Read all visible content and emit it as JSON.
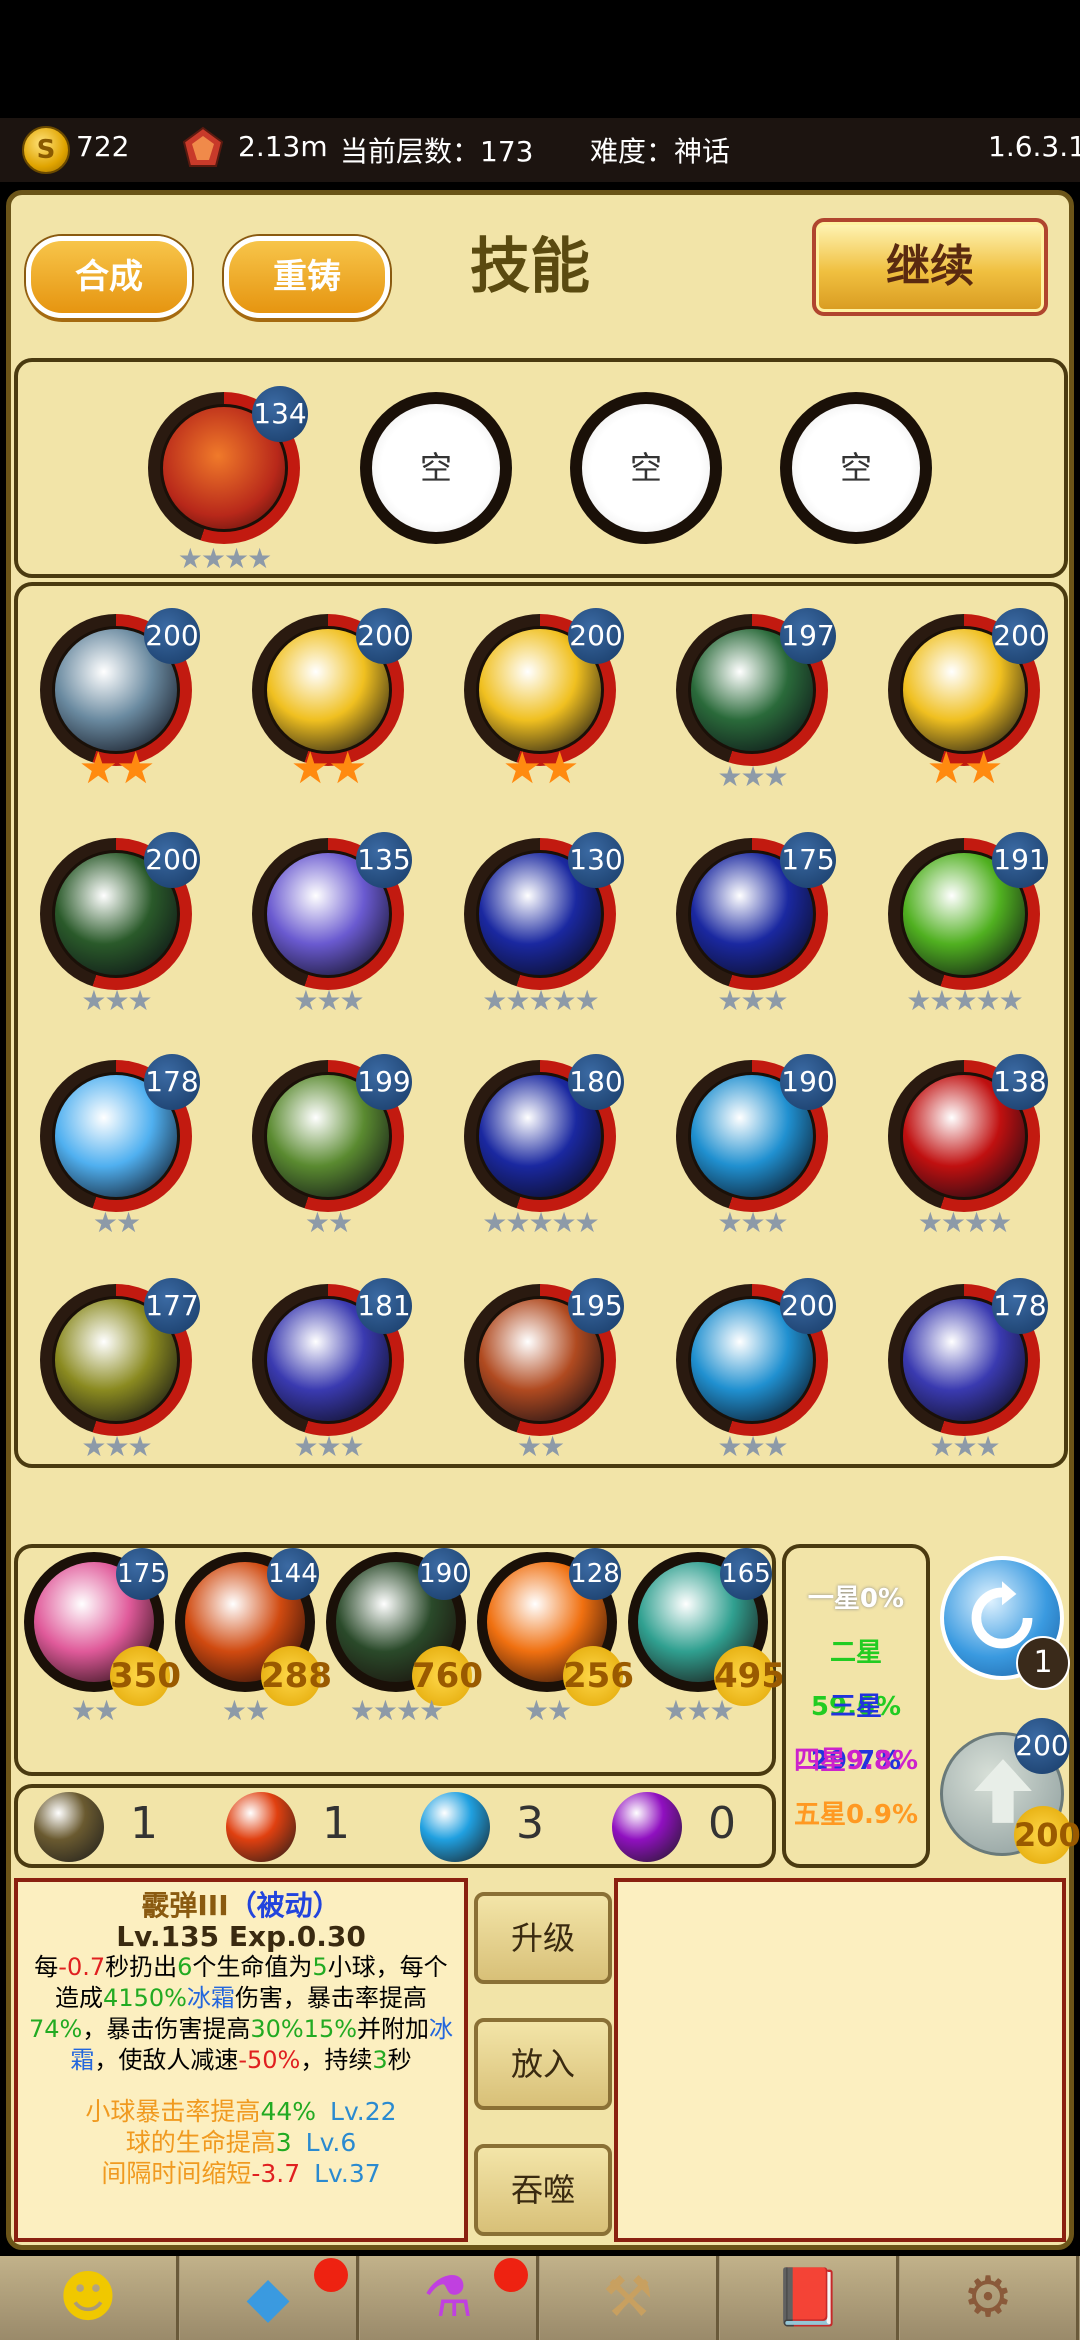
{
  "topbar": {
    "gold": "722",
    "power": "2.13m",
    "floor": "当前层数：173",
    "difficulty": "难度：神话",
    "version": "1.6.3.1",
    "coin_icon": "S"
  },
  "header": {
    "title": "技能",
    "compose_label": "合成",
    "reforge_label": "重铸",
    "continue_label": "继续"
  },
  "equipped": [
    {
      "level": "134",
      "stars": "★★★★",
      "color": "#b8281a"
    },
    {
      "empty": "空"
    },
    {
      "empty": "空"
    },
    {
      "empty": "空"
    }
  ],
  "grid": [
    {
      "level": "200",
      "stars": "★★",
      "gold": true,
      "color": "#6a8aa0"
    },
    {
      "level": "200",
      "stars": "★★",
      "gold": true,
      "color": "#f0c020"
    },
    {
      "level": "200",
      "stars": "★★",
      "gold": true,
      "color": "#f0c020"
    },
    {
      "level": "197",
      "stars": "★★★",
      "gold": false,
      "color": "#2a6a3a"
    },
    {
      "level": "200",
      "stars": "★★",
      "gold": true,
      "color": "#f0c020"
    },
    {
      "level": "200",
      "stars": "★★★",
      "gold": false,
      "color": "#2a5a2a"
    },
    {
      "level": "135",
      "stars": "★★★",
      "gold": false,
      "color": "#6a5ad0"
    },
    {
      "level": "130",
      "stars": "★★★★★",
      "gold": false,
      "color": "#1a28a0"
    },
    {
      "level": "175",
      "stars": "★★★",
      "gold": false,
      "color": "#1a28a0"
    },
    {
      "level": "191",
      "stars": "★★★★★",
      "gold": false,
      "color": "#50b020"
    },
    {
      "level": "178",
      "stars": "★★",
      "gold": false,
      "color": "#50b0f0"
    },
    {
      "level": "199",
      "stars": "★★",
      "gold": false,
      "color": "#5a8a30"
    },
    {
      "level": "180",
      "stars": "★★★★★",
      "gold": false,
      "color": "#1a28a0"
    },
    {
      "level": "190",
      "stars": "★★★",
      "gold": false,
      "color": "#2090d0"
    },
    {
      "level": "138",
      "stars": "★★★★",
      "gold": false,
      "color": "#c01010"
    },
    {
      "level": "177",
      "stars": "★★★",
      "gold": false,
      "color": "#8a8a20"
    },
    {
      "level": "181",
      "stars": "★★★",
      "gold": false,
      "color": "#3a3ab0"
    },
    {
      "level": "195",
      "stars": "★★",
      "gold": false,
      "color": "#b04a20"
    },
    {
      "level": "200",
      "stars": "★★★",
      "gold": false,
      "color": "#2090d0"
    },
    {
      "level": "178",
      "stars": "★★★",
      "gold": false,
      "color": "#3a3ab0"
    }
  ],
  "shop": [
    {
      "level": "175",
      "cost": "350",
      "stars": "★★",
      "color": "#e05a9a"
    },
    {
      "level": "144",
      "cost": "288",
      "stars": "★★",
      "color": "#d04a10"
    },
    {
      "level": "190",
      "cost": "760",
      "stars": "★★★★",
      "color": "#2a4a2a"
    },
    {
      "level": "128",
      "cost": "256",
      "stars": "★★",
      "color": "#f07010"
    },
    {
      "level": "165",
      "cost": "495",
      "stars": "★★★",
      "color": "#30a090"
    }
  ],
  "probs": [
    {
      "text": "一星0%",
      "color": "#ffffff"
    },
    {
      "text": "二星59.6%",
      "color": "#22cc22"
    },
    {
      "text": "三星29.7%",
      "color": "#2233dd"
    },
    {
      "text": "四星9.8%",
      "color": "#cc22cc"
    },
    {
      "text": "五星0.9%",
      "color": "#ff9922"
    }
  ],
  "refresh_count": "1",
  "upgrade": {
    "level": "200",
    "cost": "200"
  },
  "balls": [
    {
      "count": "1",
      "color": "#6a5a30"
    },
    {
      "count": "1",
      "color": "#e04010"
    },
    {
      "count": "3",
      "color": "#20a0e0"
    },
    {
      "count": "0",
      "color": "#9010c0"
    }
  ],
  "buttons": {
    "upgrade": "升级",
    "place": "放入",
    "devour": "吞噬"
  },
  "info": {
    "name": "霰弹III",
    "tag": "（被动）",
    "level_line": "Lv.135 Exp.0.30",
    "desc_html": [
      [
        "每",
        ""
      ],
      [
        "-0.7",
        "#e02020"
      ],
      [
        "秒扔出",
        ""
      ],
      [
        "6",
        "#22aa22"
      ],
      [
        "个生命值为",
        ""
      ],
      [
        "5",
        "#22aa22"
      ],
      [
        "小球，每个造成",
        ""
      ],
      [
        "4150%",
        "#22aa22"
      ],
      [
        "冰霜",
        "#2266dd"
      ],
      [
        "伤害，暴击率提高",
        ""
      ],
      [
        "74%",
        "#22aa22"
      ],
      [
        "，暴击伤害提高",
        ""
      ],
      [
        "30%",
        "#22aa22"
      ],
      [
        "15%",
        "#22aa22"
      ],
      [
        "并附加",
        ""
      ],
      [
        "冰霜",
        "#2266dd"
      ],
      [
        "，使敌人减速",
        ""
      ],
      [
        "-50%",
        "#e02020"
      ],
      [
        "，持续",
        ""
      ],
      [
        "3",
        "#22aa22"
      ],
      [
        "秒",
        ""
      ]
    ],
    "bonus": [
      {
        "a": "小球暴击率提高",
        "v": "44%",
        "lv": "Lv.22"
      },
      {
        "a": "球的生命提高",
        "v": "3",
        "lv": "Lv.6"
      },
      {
        "a": "间隔时间缩短",
        "v": "-3.7",
        "lv": "Lv.37"
      }
    ]
  },
  "nav": [
    "hero-icon",
    "crystal-icon",
    "potion-icon",
    "anvil-icon",
    "book-icon",
    "gear-icon"
  ]
}
